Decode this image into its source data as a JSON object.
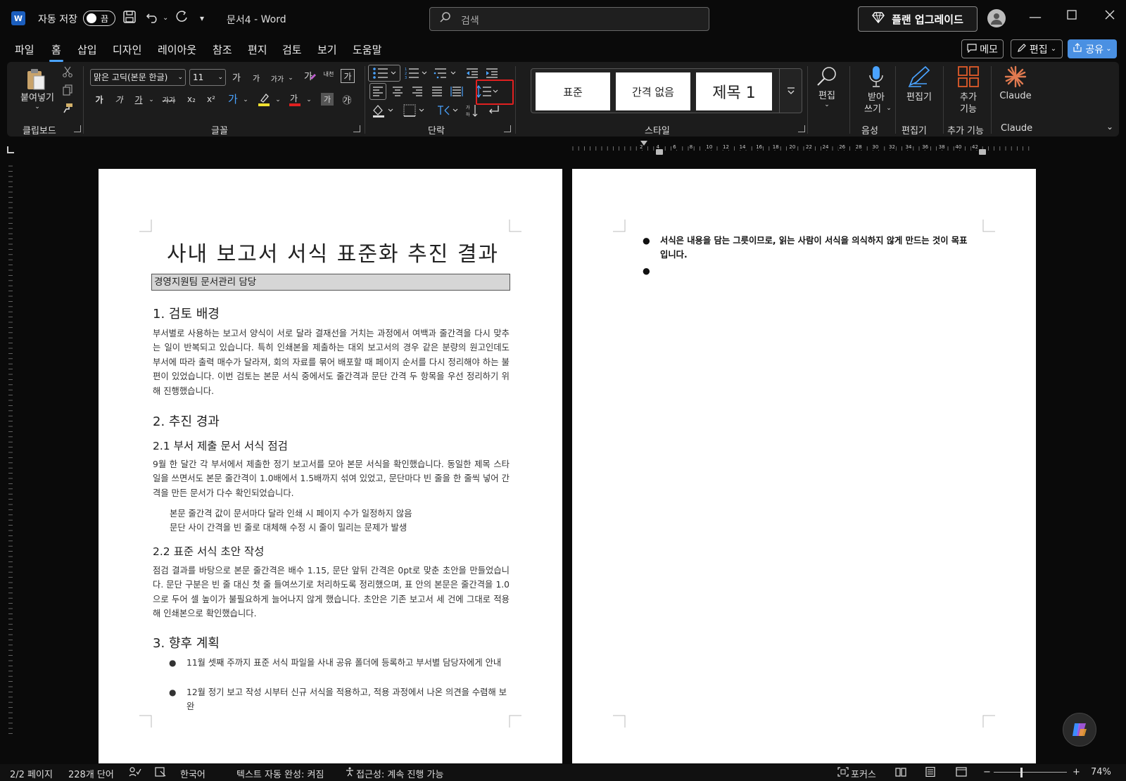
{
  "titlebar": {
    "app_logo": "W",
    "autosave_label": "자동 저장",
    "autosave_state": "끔",
    "doc_name": "문서4",
    "separator": "-",
    "app_name": "Word",
    "search_placeholder": "검색",
    "upgrade_label": "플랜 업그레이드"
  },
  "tabs": [
    "파일",
    "홈",
    "삽입",
    "디자인",
    "레이아웃",
    "참조",
    "편지",
    "검토",
    "보기",
    "도움말"
  ],
  "tab_actions": {
    "memo": "메모",
    "edit": "편집",
    "share": "공유"
  },
  "ribbon": {
    "clipboard": {
      "paste": "붙여넣기",
      "group": "클립보드"
    },
    "font": {
      "name": "맑은 고딕(본문 한글)",
      "size": "11",
      "group": "글꼴",
      "grow": "가",
      "shrink": "가",
      "case": "가가",
      "phonetic": "내천",
      "enclose": "가",
      "bold": "가",
      "italic": "가",
      "underline": "가",
      "strike": "가가",
      "sub": "x₂",
      "sup": "x²",
      "font_color": "가",
      "char_shade": "가",
      "circle": "㉮"
    },
    "paragraph": {
      "group": "단락"
    },
    "styles": {
      "group": "스타일",
      "items": [
        "표준",
        "간격 없음",
        "제목 1"
      ]
    },
    "editing": {
      "label": "편집"
    },
    "voice": {
      "label1": "받아",
      "label2": "쓰기",
      "group": "음성"
    },
    "editor": {
      "label": "편집기",
      "group": "편집기"
    },
    "addins": {
      "label1": "추가",
      "label2": "기능",
      "group": "추가 기능"
    },
    "claude": {
      "label": "Claude",
      "group": "Claude"
    }
  },
  "ruler_numbers": [
    "2",
    "4",
    "6",
    "8",
    "10",
    "12",
    "14",
    "16",
    "18",
    "20",
    "22",
    "24",
    "26",
    "28",
    "30",
    "32",
    "34",
    "36",
    "38",
    "40",
    "42"
  ],
  "document": {
    "title": "사내 보고서 서식 표준화 추진 결과",
    "author": "경영지원팀 문서관리 담당",
    "s1_heading": "1. 검토 배경",
    "s1_para": "부서별로 사용하는 보고서 양식이 서로 달라 결재선을 거치는 과정에서 여백과 줄간격을 다시 맞추는 일이 반복되고 있습니다. 특히 인쇄본을 제출하는 대외 보고서의 경우 같은 분량의 원고인데도 부서에 따라 출력 매수가 달라져, 회의 자료를 묶어 배포할 때 페이지 순서를 다시 정리해야 하는 불편이 있었습니다. 이번 검토는 본문 서식 중에서도 줄간격과 문단 간격 두 항목을 우선 정리하기 위해 진행했습니다.",
    "s2_heading": "2. 추진 경과",
    "s21_heading": "2.1 부서 제출 문서 서식 점검",
    "s21_para": "9월 한 달간 각 부서에서 제출한 정기 보고서를 모아 본문 서식을 확인했습니다. 동일한 제목 스타일을 쓰면서도 본문 줄간격이 1.0배에서 1.5배까지 섞여 있었고, 문단마다 빈 줄을 한 줄씩 넣어 간격을 만든 문서가 다수 확인되었습니다.",
    "s21_line1": "본문 줄간격 값이 문서마다 달라 인쇄 시 페이지 수가 일정하지 않음",
    "s21_line2": "문단 사이 간격을 빈 줄로 대체해 수정 시 줄이 밀리는 문제가 발생",
    "s22_heading": "2.2 표준 서식 초안 작성",
    "s22_para": "점검 결과를 바탕으로 본문 줄간격은 배수 1.15, 문단 앞뒤 간격은 0pt로 맞춘 초안을 만들었습니다. 문단 구분은 빈 줄 대신 첫 줄 들여쓰기로 처리하도록 정리했으며, 표 안의 본문은 줄간격을 1.0으로 두어 셀 높이가 불필요하게 늘어나지 않게 했습니다. 초안은 기존 보고서 세 건에 그대로 적용해 인쇄본으로 확인했습니다.",
    "s3_heading": "3. 향후 계획",
    "s3_bullet1": "11월 셋째 주까지 표준 서식 파일을 사내 공유 폴더에 등록하고 부서별 담당자에게 안내",
    "s3_bullet2": "12월 정기 보고 작성 시부터 신규 서식을 적용하고, 적용 과정에서 나온 의견을 수렴해 보완",
    "p2_bullet1": "서식은 내용을 담는 그릇이므로, 읽는 사람이 서식을 의식하지 않게 만드는 것이 목표입니다.",
    "bullet_char": "●"
  },
  "statusbar": {
    "page": "2/2 페이지",
    "words": "228개 단어",
    "language": "한국어",
    "autocomplete": "텍스트 자동 완성: 켜짐",
    "accessibility": "접근성: 계속 진행 가능",
    "focus": "포커스",
    "zoom_minus": "−",
    "zoom_plus": "+",
    "zoom": "74%"
  },
  "colors": {
    "accent": "#4aa3ff",
    "share": "#4a90e2",
    "highlight": "#e02020",
    "background": "#0a0a0a",
    "ribbon": "#1c1c1c"
  }
}
